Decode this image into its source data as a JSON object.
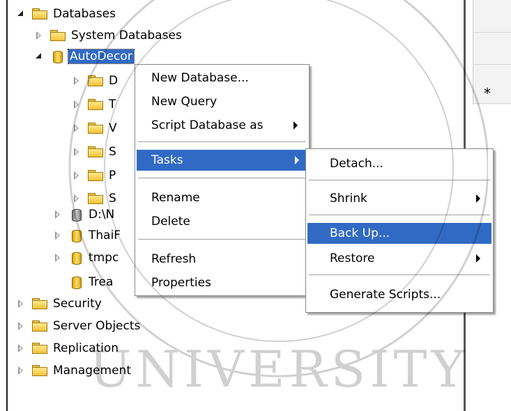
{
  "tree": {
    "databases": "Databases",
    "system_databases": "System Databases",
    "autodecor": "AutoDecor",
    "sub": [
      "D",
      "T",
      "V",
      "S",
      "P",
      "S"
    ],
    "attached": "D:\\N",
    "thai": "ThaiF",
    "tmp": "tmpc",
    "trea": "Trea",
    "security": "Security",
    "server_objects": "Server Objects",
    "replication": "Replication",
    "management": "Management"
  },
  "context_menu": {
    "new_database": "New Database...",
    "new_query": "New Query",
    "script_database_as": "Script Database as",
    "tasks": "Tasks",
    "rename": "Rename",
    "delete": "Delete",
    "refresh": "Refresh",
    "properties": "Properties"
  },
  "tasks_menu": {
    "detach": "Detach...",
    "shrink": "Shrink",
    "back_up": "Back Up...",
    "restore": "Restore",
    "generate_scripts": "Generate Scripts..."
  },
  "grid": {
    "new_row_marker": "*"
  },
  "colors": {
    "selection": "#316ac5"
  }
}
